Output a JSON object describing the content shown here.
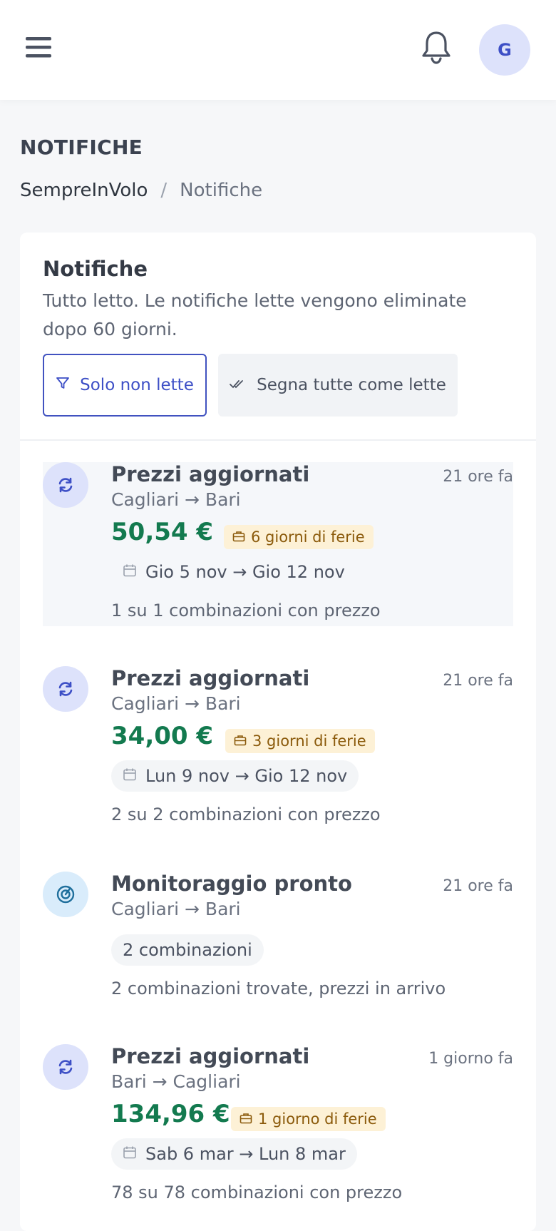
{
  "header": {
    "menu_icon": "hamburger-icon",
    "bell_icon": "bell-icon",
    "avatar_initial": "G",
    "accent_color": "#3d4fc6"
  },
  "page": {
    "title": "NOTIFICHE",
    "breadcrumb": {
      "home": "SempreInVolo",
      "separator": "/",
      "current": "Notifiche"
    }
  },
  "card": {
    "title": "Notifiche",
    "subtitle": "Tutto letto. Le notifiche lette vengono eliminate dopo 60 giorni.",
    "filter_button": {
      "label": "Solo non lette",
      "icon": "filter-icon"
    },
    "mark_all_button": {
      "label": "Segna tutte come lette",
      "icon": "double-check-icon"
    }
  },
  "notifications": [
    {
      "type": "prices-updated",
      "icon": "sync-icon",
      "title": "Prezzi aggiornati",
      "time": "21 ore fa",
      "route": "Cagliari → Bari",
      "price": "50,54 €",
      "vacation": "6 giorni di ferie",
      "dates": "Gio 5 nov → Gio 12 nov",
      "combinations": "1 su 1 combinazioni con prezzo",
      "highlighted": true
    },
    {
      "type": "prices-updated",
      "icon": "sync-icon",
      "title": "Prezzi aggiornati",
      "time": "21 ore fa",
      "route": "Cagliari → Bari",
      "price": "34,00 €",
      "vacation": "3 giorni di ferie",
      "dates": "Lun 9 nov → Gio 12 nov",
      "combinations": "2 su 2 combinazioni con prezzo",
      "highlighted": false
    },
    {
      "type": "monitoring-ready",
      "icon": "radar-icon",
      "title": "Monitoraggio pronto",
      "time": "21 ore fa",
      "route": "Cagliari → Bari",
      "badge": "2 combinazioni",
      "message": "2 combinazioni trovate, prezzi in arrivo",
      "highlighted": false
    },
    {
      "type": "prices-updated",
      "icon": "sync-icon",
      "title": "Prezzi aggiornati",
      "time": "1 giorno fa",
      "route": "Bari → Cagliari",
      "price": "134,96 €",
      "vacation": "1 giorno di ferie",
      "dates": "Sab 6 mar → Lun 8 mar",
      "combinations": "78 su 78 combinazioni con prezzo",
      "highlighted": false
    }
  ],
  "colors": {
    "price_green": "#137a4f",
    "vacation_bg": "#fdf1d6",
    "vacation_text": "#8b5a0b",
    "icon_bg_sync": "#dde2fb",
    "icon_bg_monitor": "#d9ecfb"
  }
}
